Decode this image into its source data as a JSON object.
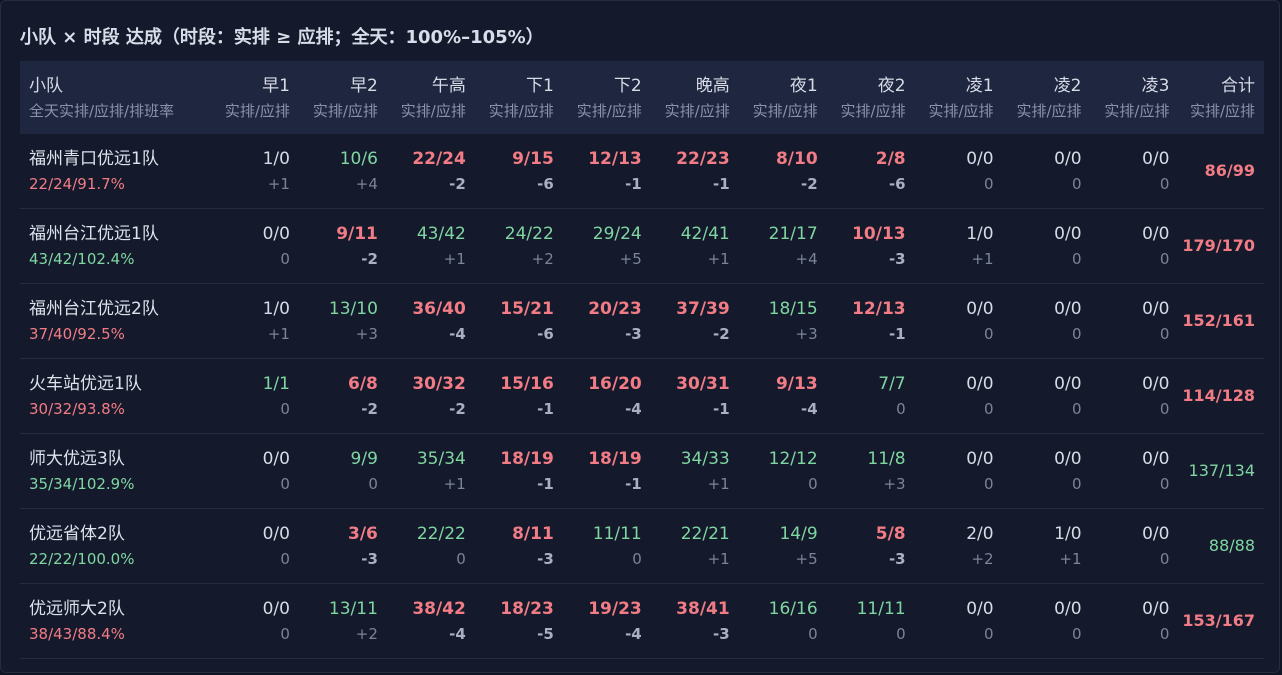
{
  "title": "小队 × 时段 达成（时段：实排 ≥ 应排；全天：100%–105%）",
  "colors": {
    "good": "#7fd6a1",
    "bad": "#f27c85",
    "neutral": "#d6dbe6",
    "muted": "#7c849a"
  },
  "header": {
    "team_label": "小队",
    "team_sub": "全天实排/应排/排班率",
    "slot_sub": "实排/应排",
    "slots": [
      "早1",
      "早2",
      "午高",
      "下1",
      "下2",
      "晚高",
      "夜1",
      "夜2",
      "凌1",
      "凌2",
      "凌3"
    ],
    "total_label": "合计",
    "total_sub": "实排/应排"
  },
  "rows": [
    {
      "team": "福州青口优远1队",
      "rate": "22/24/91.7%",
      "rate_status": "bad",
      "cells": [
        {
          "v": "1/0",
          "d": "+1",
          "s": "neutral"
        },
        {
          "v": "10/6",
          "d": "+4",
          "s": "good"
        },
        {
          "v": "22/24",
          "d": "-2",
          "s": "bad"
        },
        {
          "v": "9/15",
          "d": "-6",
          "s": "bad"
        },
        {
          "v": "12/13",
          "d": "-1",
          "s": "bad"
        },
        {
          "v": "22/23",
          "d": "-1",
          "s": "bad"
        },
        {
          "v": "8/10",
          "d": "-2",
          "s": "bad"
        },
        {
          "v": "2/8",
          "d": "-6",
          "s": "bad"
        },
        {
          "v": "0/0",
          "d": "0",
          "s": "neutral"
        },
        {
          "v": "0/0",
          "d": "0",
          "s": "neutral"
        },
        {
          "v": "0/0",
          "d": "0",
          "s": "neutral"
        }
      ],
      "total": "86/99",
      "total_status": "bad"
    },
    {
      "team": "福州台江优远1队",
      "rate": "43/42/102.4%",
      "rate_status": "good",
      "cells": [
        {
          "v": "0/0",
          "d": "0",
          "s": "neutral"
        },
        {
          "v": "9/11",
          "d": "-2",
          "s": "bad"
        },
        {
          "v": "43/42",
          "d": "+1",
          "s": "good"
        },
        {
          "v": "24/22",
          "d": "+2",
          "s": "good"
        },
        {
          "v": "29/24",
          "d": "+5",
          "s": "good"
        },
        {
          "v": "42/41",
          "d": "+1",
          "s": "good"
        },
        {
          "v": "21/17",
          "d": "+4",
          "s": "good"
        },
        {
          "v": "10/13",
          "d": "-3",
          "s": "bad"
        },
        {
          "v": "1/0",
          "d": "+1",
          "s": "neutral"
        },
        {
          "v": "0/0",
          "d": "0",
          "s": "neutral"
        },
        {
          "v": "0/0",
          "d": "0",
          "s": "neutral"
        }
      ],
      "total": "179/170",
      "total_status": "bad"
    },
    {
      "team": "福州台江优远2队",
      "rate": "37/40/92.5%",
      "rate_status": "bad",
      "cells": [
        {
          "v": "1/0",
          "d": "+1",
          "s": "neutral"
        },
        {
          "v": "13/10",
          "d": "+3",
          "s": "good"
        },
        {
          "v": "36/40",
          "d": "-4",
          "s": "bad"
        },
        {
          "v": "15/21",
          "d": "-6",
          "s": "bad"
        },
        {
          "v": "20/23",
          "d": "-3",
          "s": "bad"
        },
        {
          "v": "37/39",
          "d": "-2",
          "s": "bad"
        },
        {
          "v": "18/15",
          "d": "+3",
          "s": "good"
        },
        {
          "v": "12/13",
          "d": "-1",
          "s": "bad"
        },
        {
          "v": "0/0",
          "d": "0",
          "s": "neutral"
        },
        {
          "v": "0/0",
          "d": "0",
          "s": "neutral"
        },
        {
          "v": "0/0",
          "d": "0",
          "s": "neutral"
        }
      ],
      "total": "152/161",
      "total_status": "bad"
    },
    {
      "team": "火车站优远1队",
      "rate": "30/32/93.8%",
      "rate_status": "bad",
      "cells": [
        {
          "v": "1/1",
          "d": "0",
          "s": "good"
        },
        {
          "v": "6/8",
          "d": "-2",
          "s": "bad"
        },
        {
          "v": "30/32",
          "d": "-2",
          "s": "bad"
        },
        {
          "v": "15/16",
          "d": "-1",
          "s": "bad"
        },
        {
          "v": "16/20",
          "d": "-4",
          "s": "bad"
        },
        {
          "v": "30/31",
          "d": "-1",
          "s": "bad"
        },
        {
          "v": "9/13",
          "d": "-4",
          "s": "bad"
        },
        {
          "v": "7/7",
          "d": "0",
          "s": "good"
        },
        {
          "v": "0/0",
          "d": "0",
          "s": "neutral"
        },
        {
          "v": "0/0",
          "d": "0",
          "s": "neutral"
        },
        {
          "v": "0/0",
          "d": "0",
          "s": "neutral"
        }
      ],
      "total": "114/128",
      "total_status": "bad"
    },
    {
      "team": "师大优远3队",
      "rate": "35/34/102.9%",
      "rate_status": "good",
      "cells": [
        {
          "v": "0/0",
          "d": "0",
          "s": "neutral"
        },
        {
          "v": "9/9",
          "d": "0",
          "s": "good"
        },
        {
          "v": "35/34",
          "d": "+1",
          "s": "good"
        },
        {
          "v": "18/19",
          "d": "-1",
          "s": "bad"
        },
        {
          "v": "18/19",
          "d": "-1",
          "s": "bad"
        },
        {
          "v": "34/33",
          "d": "+1",
          "s": "good"
        },
        {
          "v": "12/12",
          "d": "0",
          "s": "good"
        },
        {
          "v": "11/8",
          "d": "+3",
          "s": "good"
        },
        {
          "v": "0/0",
          "d": "0",
          "s": "neutral"
        },
        {
          "v": "0/0",
          "d": "0",
          "s": "neutral"
        },
        {
          "v": "0/0",
          "d": "0",
          "s": "neutral"
        }
      ],
      "total": "137/134",
      "total_status": "good"
    },
    {
      "team": "优远省体2队",
      "rate": "22/22/100.0%",
      "rate_status": "good",
      "cells": [
        {
          "v": "0/0",
          "d": "0",
          "s": "neutral"
        },
        {
          "v": "3/6",
          "d": "-3",
          "s": "bad"
        },
        {
          "v": "22/22",
          "d": "0",
          "s": "good"
        },
        {
          "v": "8/11",
          "d": "-3",
          "s": "bad"
        },
        {
          "v": "11/11",
          "d": "0",
          "s": "good"
        },
        {
          "v": "22/21",
          "d": "+1",
          "s": "good"
        },
        {
          "v": "14/9",
          "d": "+5",
          "s": "good"
        },
        {
          "v": "5/8",
          "d": "-3",
          "s": "bad"
        },
        {
          "v": "2/0",
          "d": "+2",
          "s": "neutral"
        },
        {
          "v": "1/0",
          "d": "+1",
          "s": "neutral"
        },
        {
          "v": "0/0",
          "d": "0",
          "s": "neutral"
        }
      ],
      "total": "88/88",
      "total_status": "good"
    },
    {
      "team": "优远师大2队",
      "rate": "38/43/88.4%",
      "rate_status": "bad",
      "cells": [
        {
          "v": "0/0",
          "d": "0",
          "s": "neutral"
        },
        {
          "v": "13/11",
          "d": "+2",
          "s": "good"
        },
        {
          "v": "38/42",
          "d": "-4",
          "s": "bad"
        },
        {
          "v": "18/23",
          "d": "-5",
          "s": "bad"
        },
        {
          "v": "19/23",
          "d": "-4",
          "s": "bad"
        },
        {
          "v": "38/41",
          "d": "-3",
          "s": "bad"
        },
        {
          "v": "16/16",
          "d": "0",
          "s": "good"
        },
        {
          "v": "11/11",
          "d": "0",
          "s": "good"
        },
        {
          "v": "0/0",
          "d": "0",
          "s": "neutral"
        },
        {
          "v": "0/0",
          "d": "0",
          "s": "neutral"
        },
        {
          "v": "0/0",
          "d": "0",
          "s": "neutral"
        }
      ],
      "total": "153/167",
      "total_status": "bad"
    }
  ]
}
